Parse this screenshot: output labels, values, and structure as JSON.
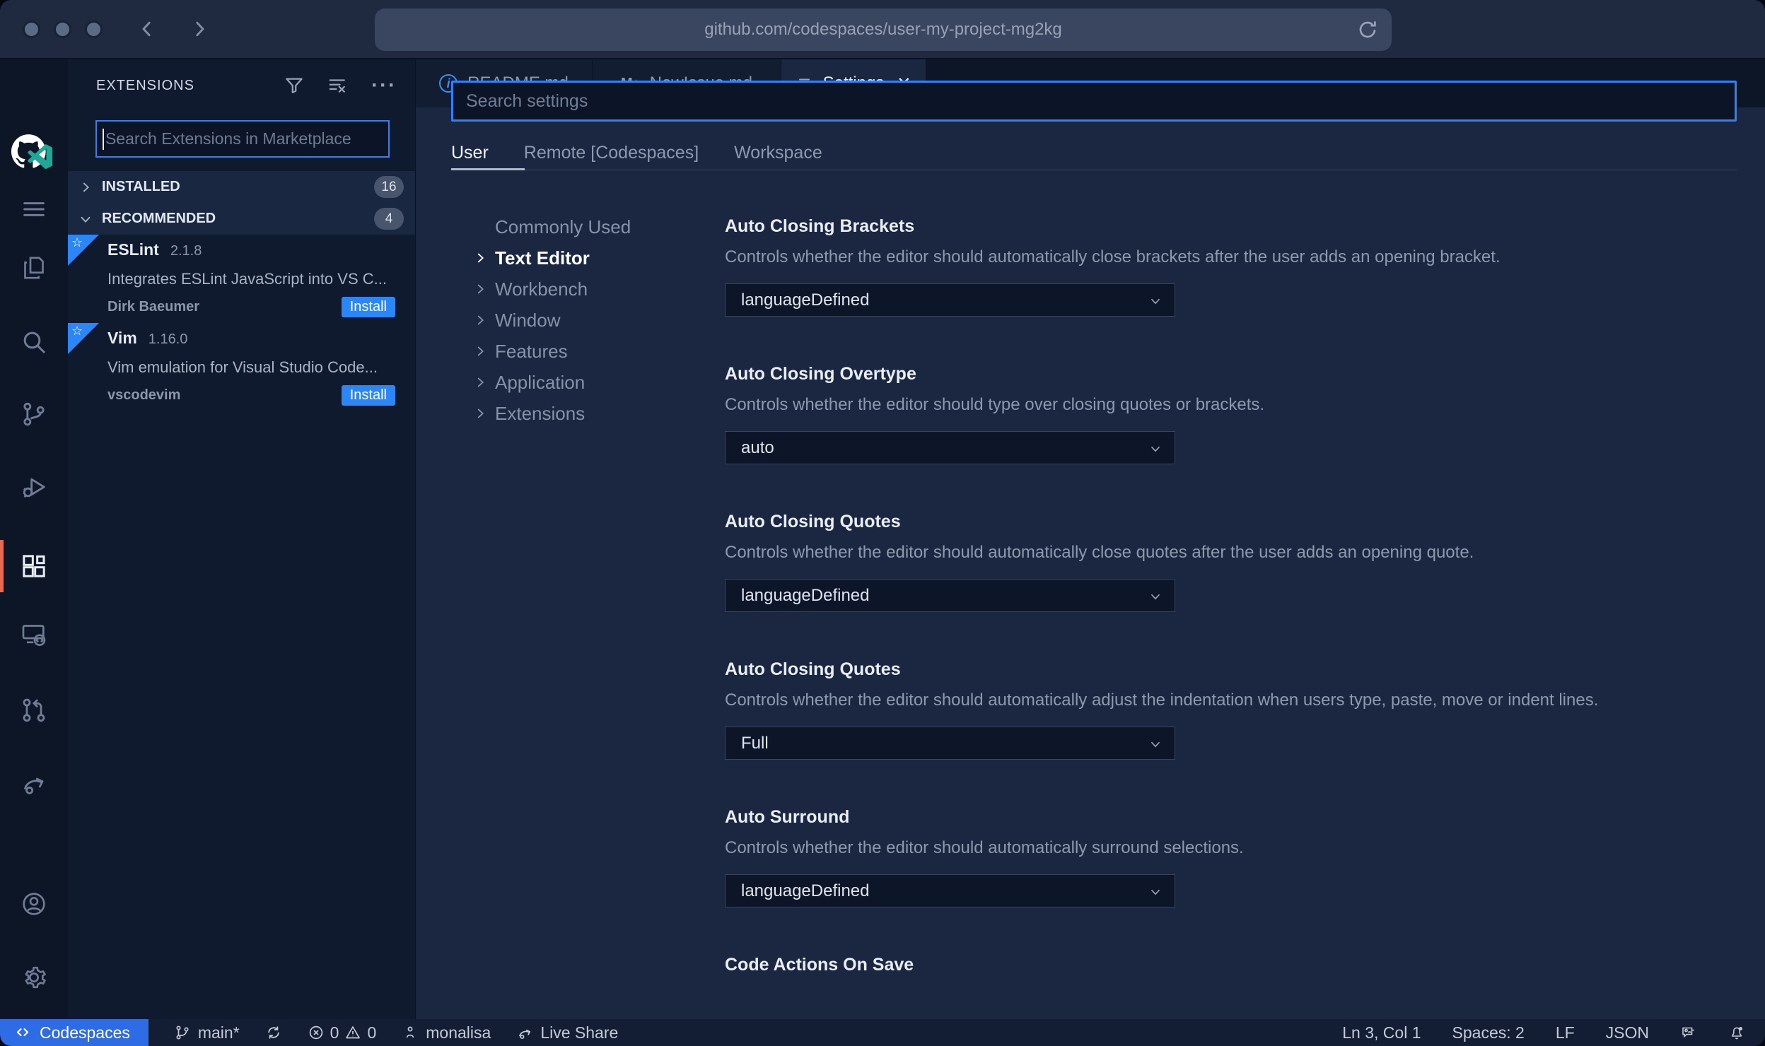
{
  "browser": {
    "url": "github.com/codespaces/user-my-project-mg2kg"
  },
  "icons": {
    "star": "☆",
    "more": "···",
    "close": "✕",
    "markdown": "M↓",
    "info": "i"
  },
  "colors": {
    "accent_blue": "#2f81f7",
    "install_blue": "#2b87f8",
    "codespaces_blue": "#2e6ce6",
    "active_indicator": "#e8694f",
    "editor_bg": "#1b2740",
    "sidebar_bg": "#0f1a2f"
  },
  "activity_bar": {
    "items": [
      "github-home",
      "menu",
      "explorer",
      "search",
      "source-control",
      "run-and-debug",
      "extensions",
      "remote-explorer",
      "pull-requests",
      "live-share",
      "account",
      "settings-gear"
    ]
  },
  "sidebar": {
    "title": "EXTENSIONS",
    "search_placeholder": "Search Extensions in Marketplace",
    "sections": [
      {
        "label": "INSTALLED",
        "count": "16"
      },
      {
        "label": "RECOMMENDED",
        "count": "4"
      }
    ],
    "extensions": [
      {
        "name": "ESLint",
        "version": "2.1.8",
        "description": "Integrates ESLint JavaScript into VS C...",
        "publisher": "Dirk Baeumer",
        "action": "Install"
      },
      {
        "name": "Vim",
        "version": "1.16.0",
        "description": "Vim emulation for Visual Studio Code...",
        "publisher": "vscodevim",
        "action": "Install"
      }
    ]
  },
  "editor": {
    "tabs": [
      {
        "label": "README.md"
      },
      {
        "label": "NewIssue.md"
      },
      {
        "label": "Settings"
      }
    ],
    "settings": {
      "search_placeholder": "Search settings",
      "scopes": [
        "User",
        "Remote [Codespaces]",
        "Workspace"
      ],
      "toc": [
        "Commonly Used",
        "Text Editor",
        "Workbench",
        "Window",
        "Features",
        "Application",
        "Extensions"
      ],
      "entries": [
        {
          "title": "Auto Closing Brackets",
          "description": "Controls whether the editor should automatically close brackets after the user adds an opening bracket.",
          "value": "languageDefined"
        },
        {
          "title": "Auto Closing Overtype",
          "description": "Controls whether the editor should type over closing quotes or brackets.",
          "value": "auto"
        },
        {
          "title": "Auto Closing Quotes",
          "description": "Controls whether the editor should automatically close quotes after the user adds an opening quote.",
          "value": "languageDefined"
        },
        {
          "title": "Auto Closing Quotes",
          "description": "Controls whether the editor should automatically adjust the indentation when users type, paste, move or indent lines.",
          "value": "Full"
        },
        {
          "title": "Auto Surround",
          "description": "Controls whether the editor should automatically surround selections.",
          "value": "languageDefined"
        },
        {
          "title": "Code Actions On Save"
        }
      ]
    }
  },
  "status_bar": {
    "codespaces": "Codespaces",
    "branch": "main*",
    "errors": "0",
    "warnings": "0",
    "user": "monalisa",
    "live_share": "Live Share",
    "cursor": "Ln 3, Col 1",
    "indent": "Spaces: 2",
    "eol": "LF",
    "language": "JSON"
  }
}
